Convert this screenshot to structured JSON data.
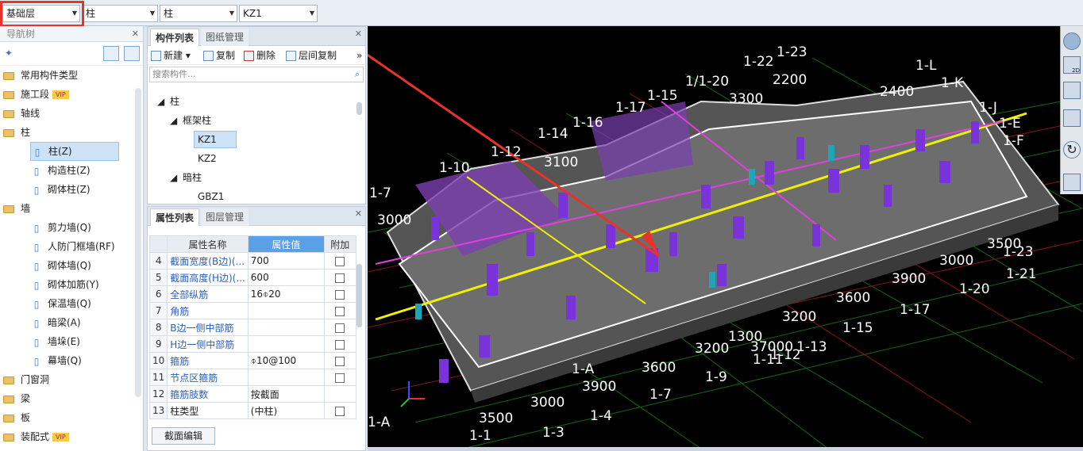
{
  "toolbar": {
    "floor": "基础层",
    "type1": "柱",
    "type2": "柱",
    "component": "KZ1"
  },
  "nav": {
    "title": "导航树",
    "items": [
      {
        "label": "常用构件类型",
        "level": 0
      },
      {
        "label": "施工段",
        "level": 0,
        "vip": "VIP"
      },
      {
        "label": "轴线",
        "level": 0
      },
      {
        "label": "柱",
        "level": 0
      },
      {
        "label": "柱(Z)",
        "level": 1,
        "selected": true,
        "icon": "column-icon"
      },
      {
        "label": "构造柱(Z)",
        "level": 1,
        "icon": "constructional-column-icon"
      },
      {
        "label": "砌体柱(Z)",
        "level": 1,
        "icon": "masonry-column-icon"
      },
      {
        "label": "墙",
        "level": 0
      },
      {
        "label": "剪力墙(Q)",
        "level": 1,
        "icon": "shear-wall-icon"
      },
      {
        "label": "人防门框墙(RF)",
        "level": 1,
        "icon": "door-frame-wall-icon"
      },
      {
        "label": "砌体墙(Q)",
        "level": 1,
        "icon": "masonry-wall-icon"
      },
      {
        "label": "砌体加筋(Y)",
        "level": 1,
        "icon": "wall-rebar-icon"
      },
      {
        "label": "保温墙(Q)",
        "level": 1,
        "icon": "insulation-wall-icon"
      },
      {
        "label": "暗梁(A)",
        "level": 1,
        "icon": "hidden-beam-icon"
      },
      {
        "label": "墙垛(E)",
        "level": 1,
        "icon": "wall-pier-icon"
      },
      {
        "label": "幕墙(Q)",
        "level": 1,
        "icon": "curtain-wall-icon"
      },
      {
        "label": "门窗洞",
        "level": 0
      },
      {
        "label": "梁",
        "level": 0
      },
      {
        "label": "板",
        "level": 0
      },
      {
        "label": "装配式",
        "level": 0,
        "vip": "VIP"
      }
    ]
  },
  "complist": {
    "tab_active": "构件列表",
    "tab_other": "图纸管理",
    "tools": {
      "new": "新建",
      "copy": "复制",
      "delete": "删除",
      "floor_copy": "层间复制"
    },
    "search_placeholder": "搜索构件...",
    "tree": {
      "root": "柱",
      "group1": "框架柱",
      "items1": [
        "KZ1",
        "KZ2"
      ],
      "group2": "暗柱",
      "items2": [
        "GBZ1"
      ]
    }
  },
  "props": {
    "tab_active": "属性列表",
    "tab_other": "图层管理",
    "headers": [
      "属性名称",
      "属性值",
      "附加"
    ],
    "rows": [
      {
        "n": "4",
        "name": "截面宽度(B边)(...",
        "value": "700",
        "blue": true,
        "chk": true
      },
      {
        "n": "5",
        "name": "截面高度(H边)(...",
        "value": "600",
        "blue": true,
        "chk": true
      },
      {
        "n": "6",
        "name": "全部纵筋",
        "value": "16⌽20",
        "blue": true,
        "chk": true
      },
      {
        "n": "7",
        "name": "角筋",
        "value": "",
        "blue": true,
        "chk": true
      },
      {
        "n": "8",
        "name": "B边一侧中部筋",
        "value": "",
        "blue": true,
        "chk": true
      },
      {
        "n": "9",
        "name": "H边一侧中部筋",
        "value": "",
        "blue": true,
        "chk": true
      },
      {
        "n": "10",
        "name": "箍筋",
        "value": "⌽10@100",
        "blue": true,
        "chk": true
      },
      {
        "n": "11",
        "name": "节点区箍筋",
        "value": "",
        "blue": true,
        "chk": true
      },
      {
        "n": "12",
        "name": "箍筋肢数",
        "value": "按截面",
        "blue": true,
        "chk": false
      },
      {
        "n": "13",
        "name": "柱类型",
        "value": "(中柱)",
        "blue": false,
        "chk": true
      }
    ],
    "section_edit": "截面编辑"
  },
  "axes": {
    "grid_labels": [
      "1-22",
      "1-23",
      "1/1-20",
      "1-L",
      "1-K",
      "1-J",
      "1-17",
      "1-16",
      "1-15",
      "1-14",
      "1-12",
      "1-10",
      "1-7",
      "1-23",
      "1-21",
      "1-20",
      "1-17",
      "1-15",
      "1-13",
      "1-12",
      "1-11",
      "1-9",
      "1-7",
      "1-4",
      "1-3",
      "1-1",
      "1-A",
      "1-E",
      "1-F"
    ],
    "dims": [
      "3300",
      "2200",
      "2400",
      "3100",
      "3500",
      "3000",
      "3900",
      "3600",
      "3200",
      "3200",
      "1300",
      "37000",
      "3600",
      "3900",
      "3000",
      "3500",
      "3000"
    ]
  }
}
